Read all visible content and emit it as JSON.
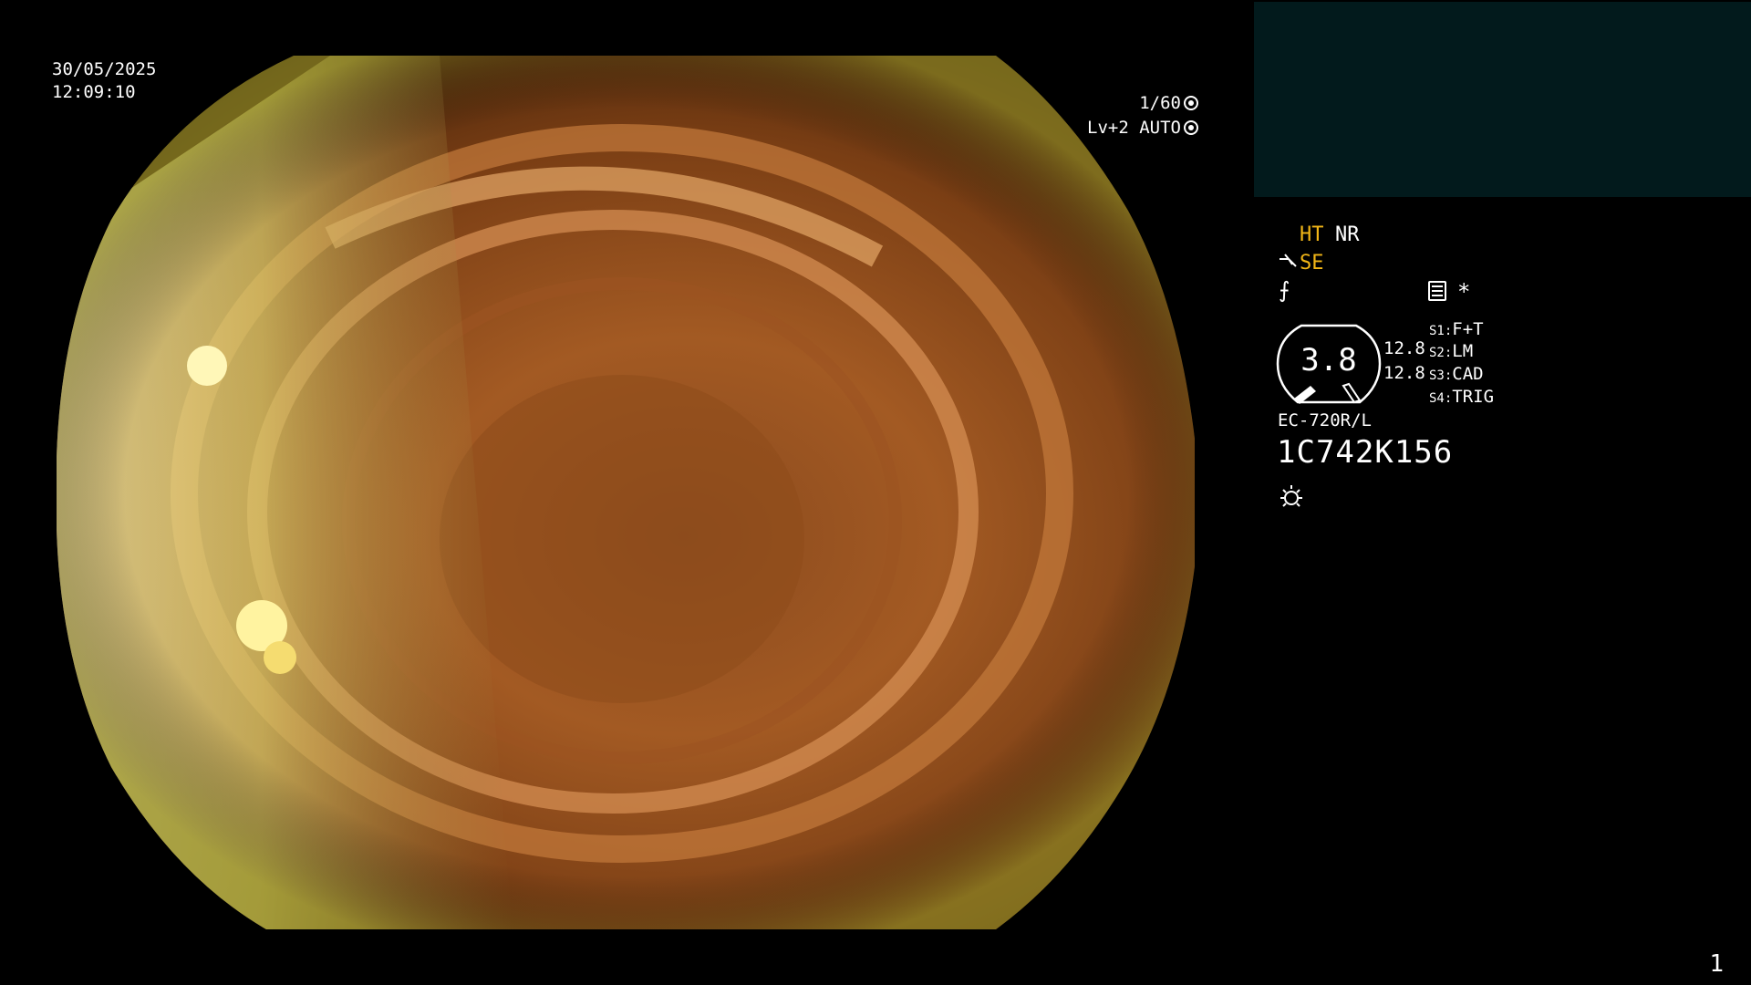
{
  "overlay": {
    "date": "30/05/2025",
    "time": "12:09:10",
    "shutter_speed": "1/60",
    "level": "Lv+2",
    "iris_mode": "AUTO"
  },
  "status_panel": {
    "ht": "HT",
    "nr": "NR",
    "se": "SE",
    "gauge_value": "3.8",
    "value_1": "12.8",
    "value_2": "12.8",
    "switches": [
      {
        "key": "S1:",
        "value": "F+T"
      },
      {
        "key": "S2:",
        "value": "LM"
      },
      {
        "key": "S3:",
        "value": "CAD"
      },
      {
        "key": "S4:",
        "value": "TRIG"
      }
    ],
    "model": "EC-720R/L",
    "serial": "1C742K156",
    "star": "*",
    "fg_symbol": "⨍"
  },
  "page_number": "1",
  "colors": {
    "highlight": "#f2b617",
    "panel_bg": "#021a1c"
  },
  "icons": [
    "shutter-icon",
    "iris-icon",
    "scope-icon",
    "menu-icon",
    "light-icon"
  ]
}
